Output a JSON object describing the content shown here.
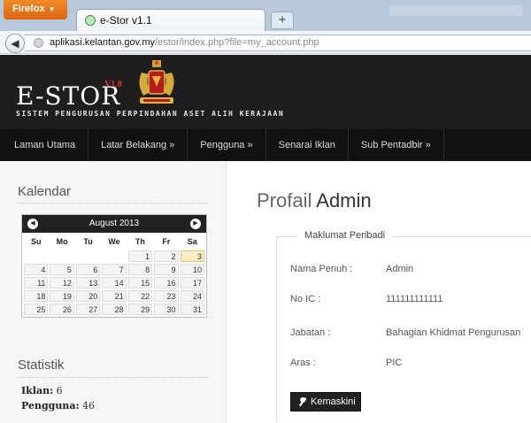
{
  "browser": {
    "app_button": "Firefox",
    "tab_title": "e-Stor v1.1",
    "newtab_label": "+",
    "url_domain": "aplikasi.kelantan.gov.my",
    "url_path": "/estor/index.php?file=my_account.php"
  },
  "header": {
    "logo": "E-STOR",
    "version": "V1.0",
    "tagline": "SISTEM PENGURUSAN PERPINDAHAN ASET ALIH KERAJAAN"
  },
  "menu": {
    "items": [
      "Laman Utama",
      "Latar Belakang »",
      "Pengguna »",
      "Senarai Iklan",
      "Sub Pentadbir »"
    ]
  },
  "sidebar": {
    "calendar_title": "Kalendar",
    "month_label": "August 2013",
    "weekdays": [
      "Su",
      "Mo",
      "Tu",
      "We",
      "Th",
      "Fr",
      "Sa"
    ],
    "weeks": [
      [
        "",
        "",
        "",
        "",
        "1",
        "2",
        "3"
      ],
      [
        "4",
        "5",
        "6",
        "7",
        "8",
        "9",
        "10"
      ],
      [
        "11",
        "12",
        "13",
        "14",
        "15",
        "16",
        "17"
      ],
      [
        "18",
        "19",
        "20",
        "21",
        "22",
        "23",
        "24"
      ],
      [
        "25",
        "26",
        "27",
        "28",
        "29",
        "30",
        "31"
      ]
    ],
    "today": "3",
    "stats_title": "Statistik",
    "stats": [
      {
        "label": "Iklan:",
        "value": "6"
      },
      {
        "label": "Pengguna:",
        "value": "46"
      }
    ]
  },
  "main": {
    "title_light": "Profail",
    "title_strong": "Admin",
    "section_legend": "Maklumat Peribadi",
    "fields": [
      {
        "label": "Nama Penuh :",
        "value": "Admin"
      },
      {
        "label": "No IC :",
        "value": "111111111111"
      },
      {
        "label": "Jabatan :",
        "value": "Bahagian Khidmat Pengurusan"
      },
      {
        "label": "Aras :",
        "value": "PIC"
      }
    ],
    "edit_button": "Kemaskini"
  },
  "colors": {
    "header_bg": "#1e1e1e",
    "menu_bg": "#111111",
    "firefox_orange": "#e8751a",
    "version_red": "#ee3333"
  }
}
